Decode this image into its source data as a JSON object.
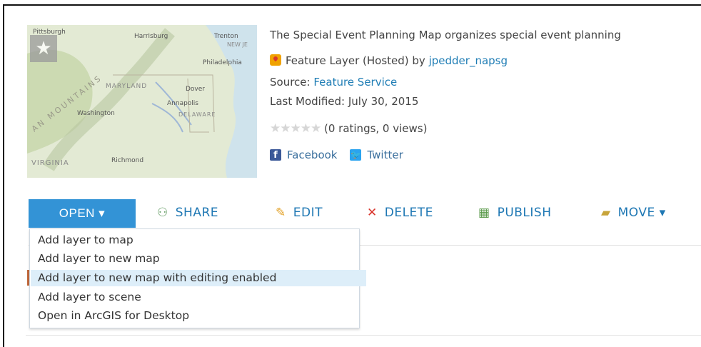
{
  "item": {
    "description": "The Special Event Planning Map organizes special event planning",
    "type_label": "Feature Layer (Hosted) by ",
    "owner": "jpedder_napsg",
    "source_label": "Source: ",
    "source_value": "Feature Service",
    "last_modified": "Last Modified: July 30, 2015",
    "rating_stars": "★★★★★",
    "rating_text": "(0 ratings, 0 views)"
  },
  "thumbnail": {
    "places": [
      "Pittsburgh",
      "Harrisburg",
      "Trenton",
      "NEW JE",
      "Philadelphia",
      "MARYLAND",
      "Dover",
      "Annapolis",
      "Washington",
      "DELAWARE",
      "VIRGINIA",
      "Richmond",
      "AN MOUNTAINS"
    ]
  },
  "social": {
    "facebook": "Facebook",
    "twitter": "Twitter"
  },
  "toolbar": {
    "open": "OPEN ▾",
    "share": "SHARE",
    "edit": "EDIT",
    "delete": "DELETE",
    "publish": "PUBLISH",
    "move": "MOVE ▾"
  },
  "dropdown": {
    "items": [
      "Add layer to map",
      "Add layer to new map",
      "Add layer to new map with editing enabled",
      "Add layer to scene",
      "Open in ArcGIS for Desktop"
    ],
    "highlighted_index": 2
  },
  "colors": {
    "accent": "#3393d6",
    "link": "#1f7db5",
    "highlight": "#ddeef9",
    "delete": "#d9342b"
  }
}
